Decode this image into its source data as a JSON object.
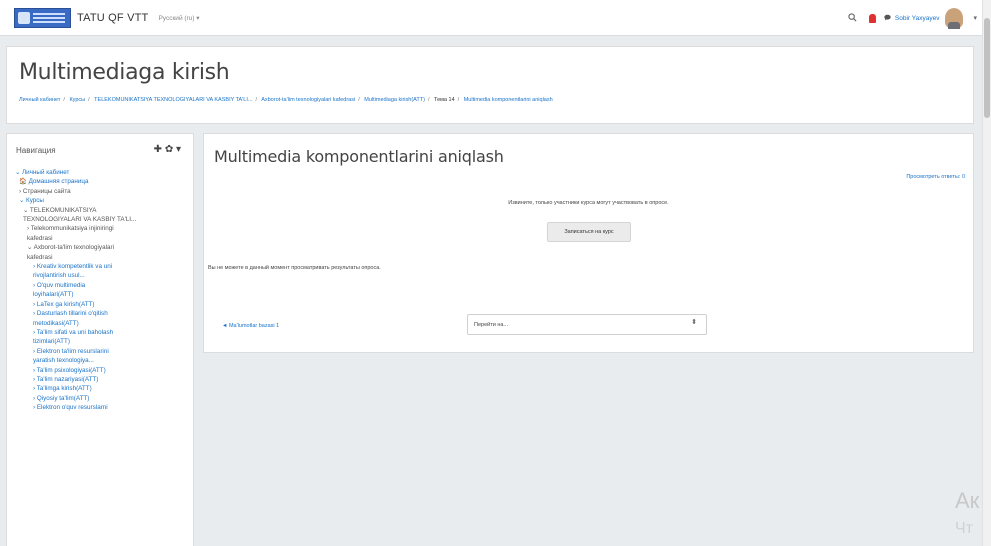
{
  "navbar": {
    "site_name": "TATU QF VTT",
    "language": "Русский (ru) ▾",
    "username": "Sobir Yaxyayev",
    "caret": "▾",
    "search_icon": "search-icon",
    "notification_icon": "bell-icon",
    "message_icon": "chat-icon"
  },
  "header": {
    "title": "Multimediaga kirish",
    "breadcrumb": [
      "Личный кабинет",
      "Курсы",
      "TELEKOMUNIKATSIYA TEXNOLOGIYALARI VA KASBIY TA'LI...",
      "Axborot-ta'lim texnologiyalari kafedrasi",
      "Multimediaga kirish(ATT)",
      "Тема 14",
      "Multimedia komponentlarini aniqlash"
    ]
  },
  "navigation": {
    "title": "Навигация",
    "actions": "✚ ✿ ▾",
    "items": [
      {
        "text": "⌄ Личный кабинет",
        "level": "l1",
        "blue": true
      },
      {
        "text": "🏠 Домашняя страница",
        "level": "l2",
        "blue": true
      },
      {
        "text": "› Страницы сайта",
        "level": "l2",
        "blue": false
      },
      {
        "text": "⌄ Курсы",
        "level": "l2",
        "blue": true
      },
      {
        "text": "⌄ TELEKOMUNIKATSIYA",
        "level": "l3",
        "blue": false
      },
      {
        "text": "TEXNOLOGIYALARI VA KASBIY TA'LI...",
        "level": "l3",
        "blue": false
      },
      {
        "text": "› Telekommunikatsiya injiniringi",
        "level": "l4",
        "blue": false
      },
      {
        "text": "kafedrasi",
        "level": "l4",
        "blue": false
      },
      {
        "text": "⌄ Axborot-ta'lim texnologiyalari",
        "level": "l4",
        "blue": false
      },
      {
        "text": "kafedrasi",
        "level": "l4",
        "blue": false
      },
      {
        "text": "› Kreativ kompetentlik va uni",
        "level": "l5",
        "blue": true
      },
      {
        "text": "rivojlantirish usul...",
        "level": "l5",
        "blue": true
      },
      {
        "text": "› O'quv multimedia",
        "level": "l5",
        "blue": true
      },
      {
        "text": "loyihalari(ATT)",
        "level": "l5",
        "blue": true
      },
      {
        "text": "› LaTex ga kirish(ATT)",
        "level": "l5",
        "blue": true
      },
      {
        "text": "› Dasturlash tillarini o'qitish",
        "level": "l5",
        "blue": true
      },
      {
        "text": "metodikasi(ATT)",
        "level": "l5",
        "blue": true
      },
      {
        "text": "› Ta'lim sifati va uni baholash",
        "level": "l5",
        "blue": true
      },
      {
        "text": "tizimlari(ATT)",
        "level": "l5",
        "blue": true
      },
      {
        "text": "› Elektron ta'lim resurslarini",
        "level": "l5",
        "blue": true
      },
      {
        "text": "yaratish texnologiya...",
        "level": "l5",
        "blue": true
      },
      {
        "text": "› Ta'lim psixologiyasi(ATT)",
        "level": "l5",
        "blue": true
      },
      {
        "text": "› Ta'lim nazariyasi(ATT)",
        "level": "l5",
        "blue": true
      },
      {
        "text": "› Ta'limga kirish(ATT)",
        "level": "l5",
        "blue": true
      },
      {
        "text": "› Qiyosiy ta'lim(ATT)",
        "level": "l5",
        "blue": true
      },
      {
        "text": "› Elektron o'quv resurslarni",
        "level": "l5",
        "blue": true
      }
    ]
  },
  "main": {
    "title": "Multimedia komponentlarini aniqlash",
    "view_responses": "Просмотреть ответы: 0",
    "notice": "Извините, только участники курса могут участвовать в опросе.",
    "enroll_button": "Записаться на курс",
    "cannot_view": "Вы не можете в данный момент просматривать результаты опроса.",
    "prev_link": "◄ Ma'lumotlar bazasi 1",
    "jump_select": "Перейти на...",
    "jump_arrows": "⬍"
  },
  "watermark": {
    "line1": "Ак",
    "line2": "Чт"
  }
}
